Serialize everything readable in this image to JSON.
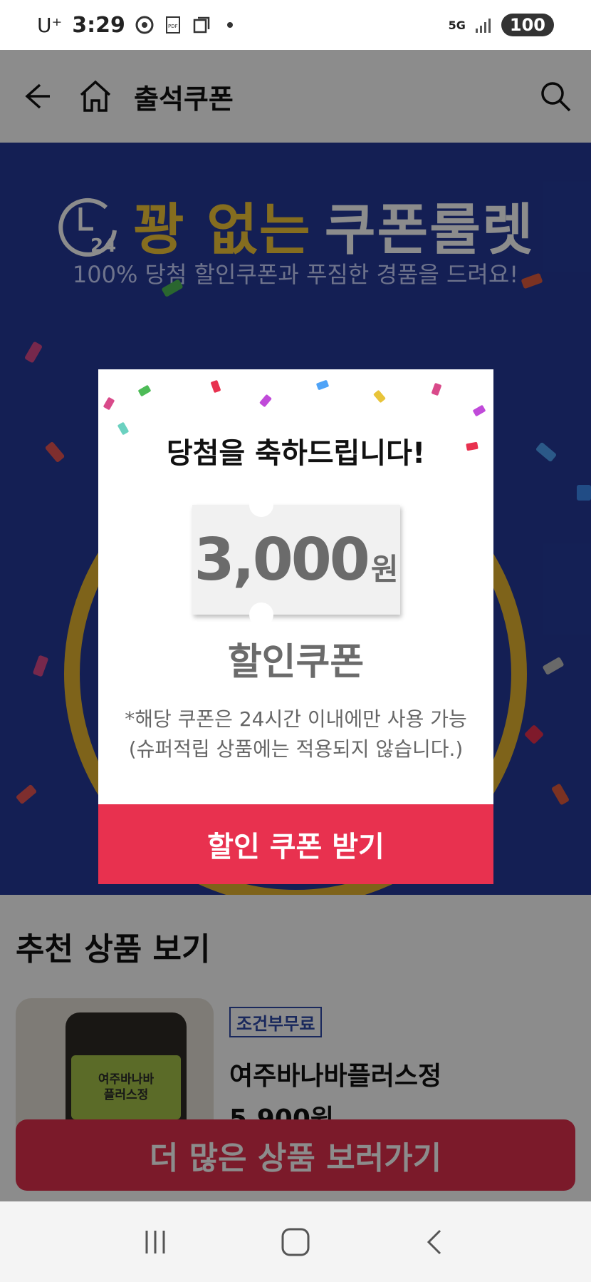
{
  "status_bar": {
    "carrier": "U⁺",
    "time": "3:29",
    "network": "5G",
    "battery": "100"
  },
  "header": {
    "title": "출석쿠폰"
  },
  "banner": {
    "clock_label": "24",
    "title_highlight": "꽝 없는",
    "title_main": "쿠폰룰렛",
    "subtitle": "100% 당첨 할인쿠폰과 푸짐한 경품을 드려요!"
  },
  "modal": {
    "title": "당첨을 축하드립니다!",
    "amount": "3,000",
    "unit": "원",
    "coupon_type": "할인쿠폰",
    "notice_line1": "*해당 쿠폰은 24시간 이내에만 사용 가능",
    "notice_line2": "(슈퍼적립 상품에는 적용되지 않습니다.)",
    "button": "할인 쿠폰 받기"
  },
  "recommend": {
    "title": "추천 상품 보기",
    "product": {
      "tag": "조건부무료",
      "name": "여주바나바플러스정",
      "price": "5,900원",
      "label_line1": "여주바나바",
      "label_line2": "플러스정"
    },
    "more_button": "더 많은 상품 보러가기"
  },
  "colors": {
    "banner_bg": "#253a9a",
    "accent_red": "#e8314f",
    "gold": "#e6b530"
  }
}
